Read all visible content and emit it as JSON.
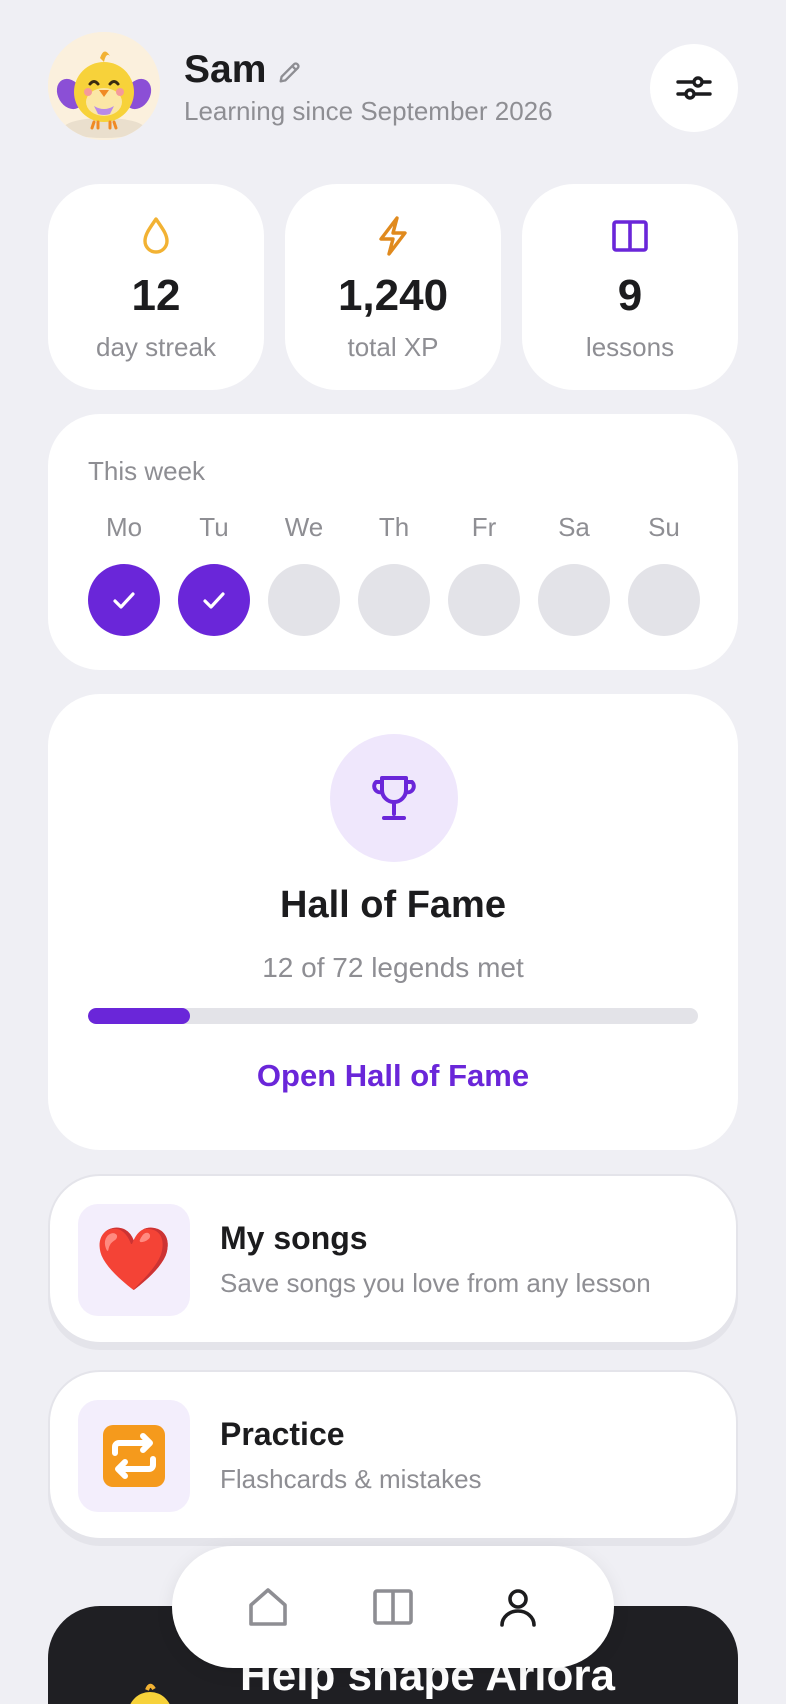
{
  "header": {
    "name": "Sam",
    "subtitle": "Learning since September 2026",
    "avatar_icon": "chick-mascot-icon",
    "edit_icon": "pencil-icon",
    "settings_icon": "sliders-icon"
  },
  "stats": [
    {
      "icon": "drop-icon",
      "value": "12",
      "label": "day streak",
      "color": "#f2b233"
    },
    {
      "icon": "lightning-icon",
      "value": "1,240",
      "label": "total XP",
      "color": "#e08a1e"
    },
    {
      "icon": "book-icon",
      "value": "9",
      "label": "lessons",
      "color": "#6a26d9"
    }
  ],
  "week": {
    "title": "This week",
    "days": [
      {
        "label": "Mo",
        "done": true
      },
      {
        "label": "Tu",
        "done": true
      },
      {
        "label": "We",
        "done": false
      },
      {
        "label": "Th",
        "done": false
      },
      {
        "label": "Fr",
        "done": false
      },
      {
        "label": "Sa",
        "done": false
      },
      {
        "label": "Su",
        "done": false
      }
    ]
  },
  "hall_of_fame": {
    "icon": "trophy-icon",
    "title": "Hall of Fame",
    "progress_text": "12 of 72 legends met",
    "progress_fraction": 0.167,
    "link_label": "Open Hall of Fame"
  },
  "rows": [
    {
      "icon": "❤️",
      "icon_name": "heart-icon",
      "title": "My songs",
      "subtitle": "Save songs you love from any lesson"
    },
    {
      "icon": "🔁",
      "icon_name": "repeat-icon",
      "title": "Practice",
      "subtitle": "Flashcards & mistakes"
    }
  ],
  "promo": {
    "title": "Help shape Ariora"
  },
  "tabbar": {
    "tabs": [
      "home-icon",
      "book-icon",
      "profile-icon"
    ]
  },
  "colors": {
    "accent": "#6a26d9",
    "background": "#efeff4",
    "muted_text": "#8e8e93"
  }
}
